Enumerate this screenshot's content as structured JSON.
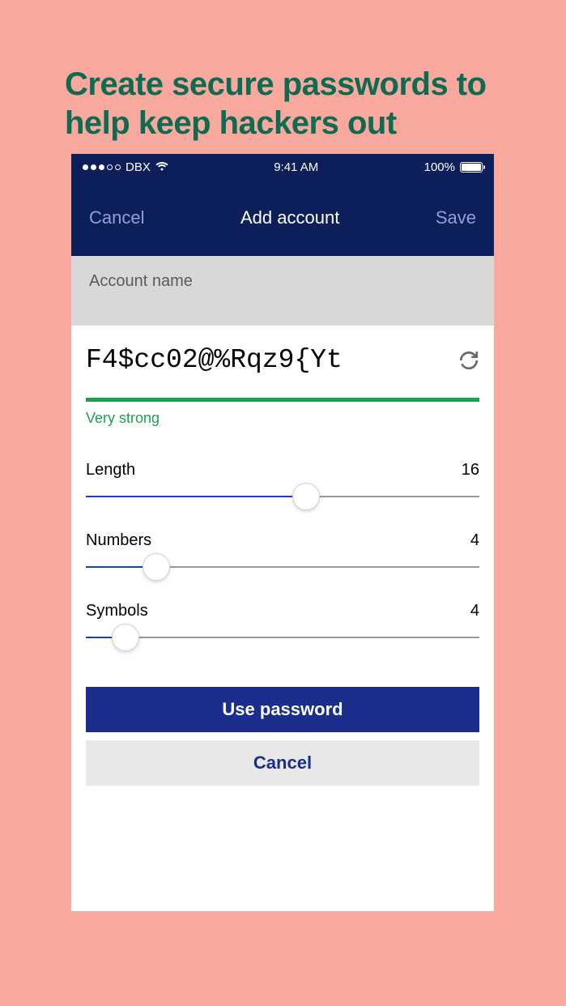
{
  "headline": "Create secure passwords to help keep hackers out",
  "status": {
    "carrier": "DBX",
    "time": "9:41 AM",
    "battery": "100%"
  },
  "nav": {
    "cancel": "Cancel",
    "title": "Add account",
    "save": "Save"
  },
  "form": {
    "account_name_label": "Account name"
  },
  "generator": {
    "password": "F4$cc02@%Rqz9{Yt",
    "strength_label": "Very strong",
    "sliders": {
      "length": {
        "label": "Length",
        "value": "16",
        "percent": 56
      },
      "numbers": {
        "label": "Numbers",
        "value": "4",
        "percent": 18
      },
      "symbols": {
        "label": "Symbols",
        "value": "4",
        "percent": 10
      }
    },
    "use_button": "Use password",
    "cancel_button": "Cancel"
  }
}
